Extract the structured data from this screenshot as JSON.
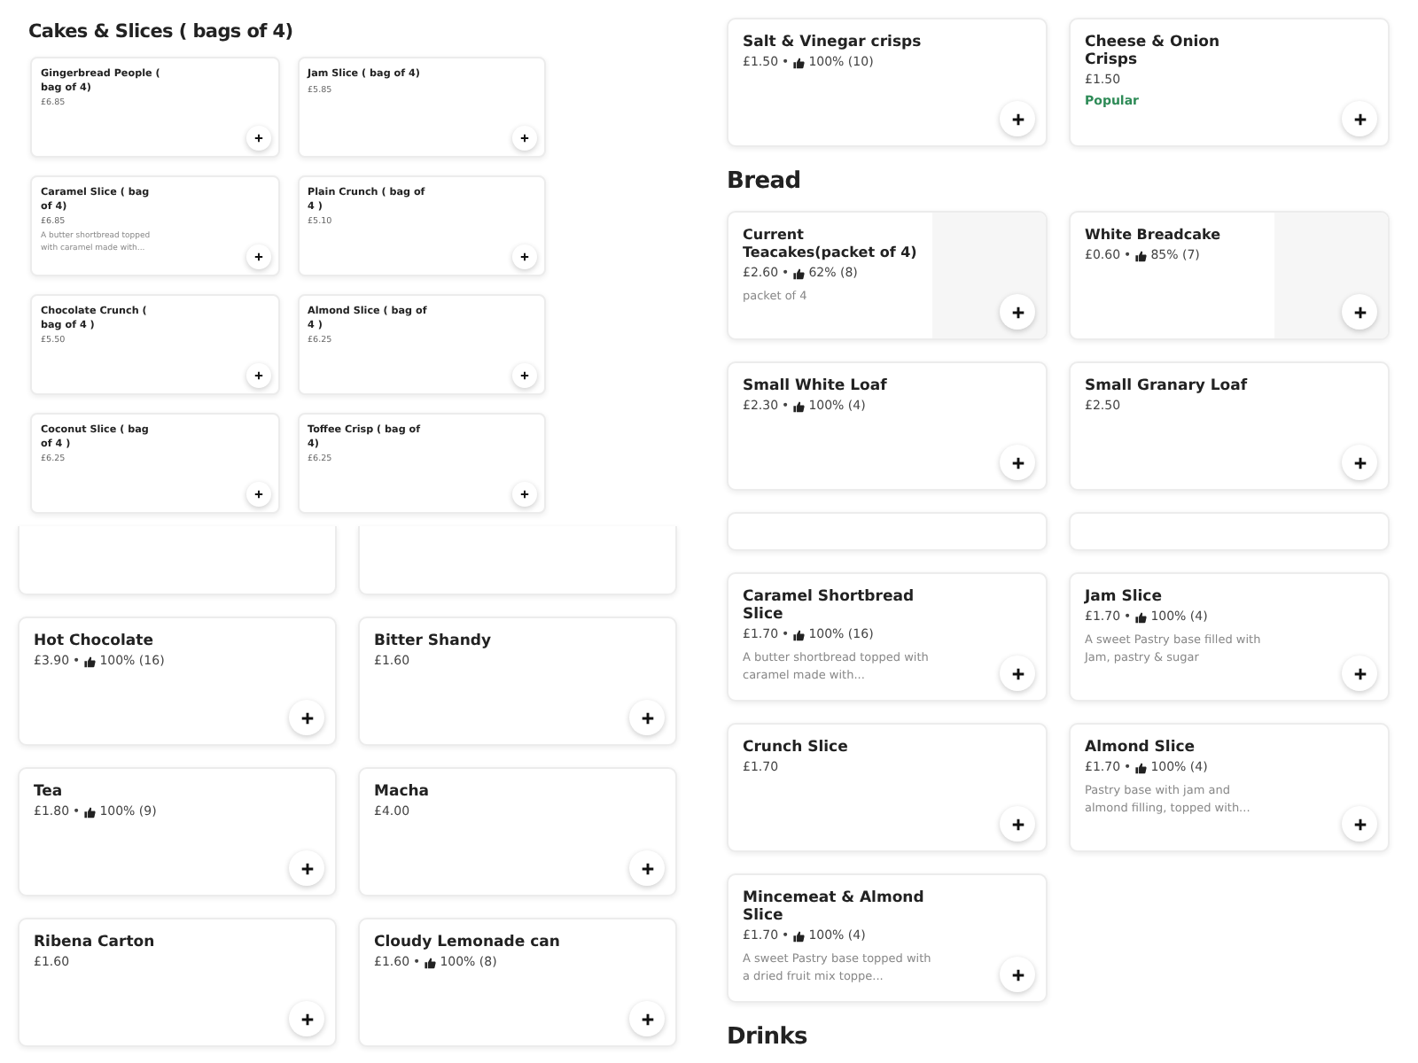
{
  "overlay": {
    "heading": "Cakes & Slices ( bags of 4)",
    "items": [
      {
        "kind": "item",
        "name": "Gingerbread People ( bag of 4)",
        "price": "£6.85"
      },
      {
        "kind": "item",
        "name": "Jam Slice ( bag of 4)",
        "price": "£5.85"
      },
      {
        "kind": "item",
        "name": "Caramel Slice ( bag of 4)",
        "price": "£6.85",
        "description": "A butter shortbread topped with caramel made with..."
      },
      {
        "kind": "item",
        "name": "Plain Crunch ( bag of 4 )",
        "price": "£5.10"
      },
      {
        "kind": "item",
        "name": "Chocolate Crunch ( bag of 4 )",
        "price": "£5.50"
      },
      {
        "kind": "item",
        "name": "Almond Slice ( bag of 4 )",
        "price": "£6.25"
      },
      {
        "kind": "item",
        "name": "Coconut Slice ( bag of 4 )",
        "price": "£6.25"
      },
      {
        "kind": "item",
        "name": "Toffee Crisp ( bag of 4)",
        "price": "£6.25"
      }
    ]
  },
  "left_cards": [
    {
      "kind": "cut"
    },
    {
      "kind": "cut"
    },
    {
      "kind": "item",
      "name": "Hot Chocolate",
      "price": "£3.90",
      "sep": "•",
      "rating": "100% (16)"
    },
    {
      "kind": "item",
      "name": "Bitter Shandy",
      "price": "£1.60"
    },
    {
      "kind": "item",
      "name": "Tea",
      "price": "£1.80",
      "sep": "•",
      "rating": "100% (9)"
    },
    {
      "kind": "item",
      "name": "Macha",
      "price": "£4.00"
    },
    {
      "kind": "item",
      "name": "Ribena Carton",
      "price": "£1.60"
    },
    {
      "kind": "item",
      "name": "Cloudy Lemonade can",
      "price": "£1.60",
      "sep": "•",
      "rating": "100% (8)"
    }
  ],
  "right_sections": [
    {
      "items": [
        {
          "kind": "item",
          "name": "Salt & Vinegar crisps",
          "price": "£1.50",
          "sep": "•",
          "rating": "100% (10)"
        },
        {
          "kind": "item",
          "name": "Cheese & Onion Crisps",
          "price": "£1.50",
          "badge": "Popular"
        }
      ]
    },
    {
      "heading": "Bread",
      "items": [
        {
          "kind": "with_image",
          "name": "Current Teacakes(packet of 4)",
          "price": "£2.60",
          "sep": "•",
          "rating": "62% (8)",
          "description": "packet of 4"
        },
        {
          "kind": "with_image",
          "name": "White Breadcake",
          "price": "£0.60",
          "sep": "•",
          "rating": "85% (7)"
        },
        {
          "kind": "item",
          "name": "Small White Loaf",
          "price": "£2.30",
          "sep": "•",
          "rating": "100% (4)"
        },
        {
          "kind": "item",
          "name": "Small Granary Loaf",
          "price": "£2.50"
        },
        {
          "kind": "cut"
        },
        {
          "kind": "cut"
        },
        {
          "kind": "item",
          "name": "Caramel Shortbread Slice",
          "price": "£1.70",
          "sep": "•",
          "rating": "100% (16)",
          "description": "A butter shortbread topped with caramel made with..."
        },
        {
          "kind": "item",
          "name": "Jam Slice",
          "price": "£1.70",
          "sep": "•",
          "rating": "100% (4)",
          "description": "A sweet Pastry base filled with Jam, pastry & sugar"
        },
        {
          "kind": "item",
          "name": "Crunch Slice",
          "price": "£1.70"
        },
        {
          "kind": "item",
          "name": "Almond Slice",
          "price": "£1.70",
          "sep": "•",
          "rating": "100% (4)",
          "description": "Pastry base with jam and almond filling, topped with..."
        },
        {
          "kind": "item",
          "name": "Mincemeat & Almond Slice",
          "price": "£1.70",
          "sep": "•",
          "rating": "100% (4)",
          "description": "A sweet Pastry base topped with a dried fruit mix toppe..."
        }
      ]
    },
    {
      "heading": "Drinks"
    }
  ]
}
